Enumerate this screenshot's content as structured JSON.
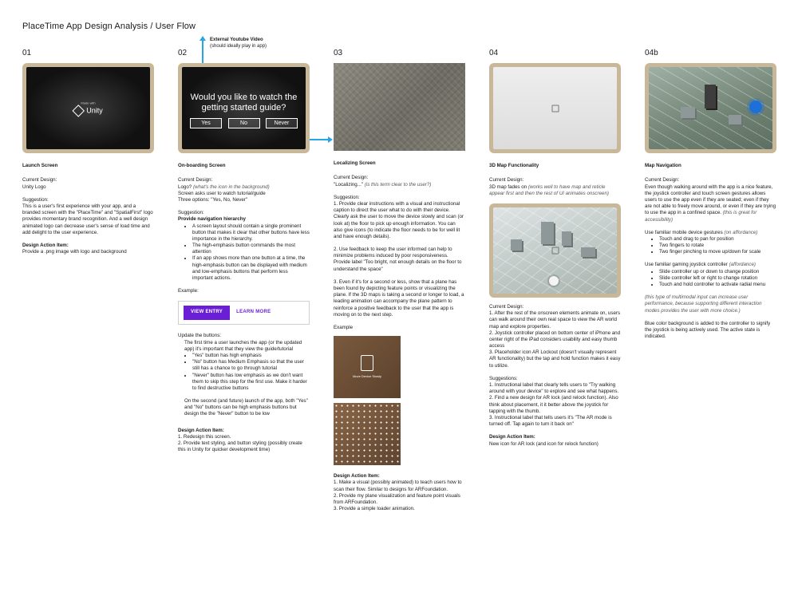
{
  "page_title": "PlaceTime App Design Analysis / User Flow",
  "annotation": {
    "label": "External Youtube Video",
    "sub": "(should ideally play in app)"
  },
  "col1": {
    "num": "01",
    "screen_caption": "Unity",
    "screen_small": "Made with",
    "heading": "Launch Screen",
    "current_label": "Current Design:",
    "current_text": "Unity Logo",
    "suggestion_label": "Suggestion:",
    "suggestion_text": "This is a user's first experience with your app, and a branded screen with the \"PlaceTime\" and \"SpatialFirst\" logo provides momentary brand recognition. And a well design animated logo can decrease user's sense of load time and add delight to the user experience.",
    "action_label": "Design Action Item:",
    "action_text": "Provide a .png image with logo and background"
  },
  "col2": {
    "num": "02",
    "screen_question": "Would you like to watch the getting started guide?",
    "btn_yes": "Yes",
    "btn_no": "No",
    "btn_never": "Never",
    "heading": "On-boarding Screen",
    "current_label": "Current Design:",
    "current_line1": "Logo?",
    "current_line1_note": "(what's the icon in the background)",
    "current_line2": "Screen asks user to watch tutorial/guide",
    "current_line3": "Three options: \"Yes, No, Never\"",
    "suggestion_label": "Suggestion:",
    "suggestion_sub": "Provide navigation hierarchy",
    "suggestion_items": [
      "A screen layout should contain a single prominent button that makes it clear that other buttons have less importance in the hierarchy.",
      "The high-emphasis button commands the most attention",
      "If an app shows more than one button at a time, the high-emphasis button can be displayed with medium and low-emphasis buttons that perform less important actions."
    ],
    "example_label": "Example:",
    "example_primary": "VIEW ENTRY",
    "example_secondary": "LEARN MORE",
    "update_label": "Update the buttons:",
    "update_intro": "The first time a user launches the app (or the updated app) it's important that they view the guide/tutorial",
    "update_items": [
      "\"Yes\" button has high emphasis",
      "\"No\" button has Medium Emphasis so that the user still has a chance to go through tutorial",
      "\"Never\" button has low emphasis as we don't want them to skip this step for the first use. Make it harder to find destructive buttons"
    ],
    "update_outro": "On the second (and future) launch of the app, both \"Yes\" and  \"No\" buttons can be high emphasis buttons but design the the \"Never\" button to be low",
    "action_label": "Design Action Item:",
    "action_items": [
      "1. Redesign this screen.",
      "2. Provide text styling, and button styling (possibly create this in Unity for quicker development time)"
    ]
  },
  "col3": {
    "num": "03",
    "heading": "Localizing Screen",
    "current_label": "Current Design:",
    "current_text": "\"Localizing...\"",
    "current_note": "(is this term clear to the user?)",
    "suggestion_label": "Suggestion:",
    "suggestions": [
      "1. Provide clear instructions with a visual and instructional caption to direct the user what to do with their device. Clearly ask the user to move the device slowly and scan (or look at) the floor to pick up enough information. You can also give icons (to indicate the floor needs to be for well lit and have enough details).",
      "2. Use feedback to keep the user informed can help to minimize problems induced by poor responsiveness. Provide label \"Too bright, not enough details on the floor to understand the space\"",
      "3. Even if it's for a second or less, show that a plane has been found by depicting feature points or visualizing the plane. If the 3D maps is taking a second or longer to load, a leading animation can accompany the plane pattern to reinforce a positive feedback to the user that the app is moving on to the next step."
    ],
    "example_label": "Example",
    "example_caption": "Move Device Slowly",
    "action_label": "Design Action Item:",
    "action_items": [
      "1. Make a visual (possibly animated) to teach users how to scan their flow. Similar to designs for ARFoundation.",
      "2. Provide my plane visualization and feature point visuals from ARFoundation.",
      "3. Provide a simple loader animation."
    ]
  },
  "col4": {
    "num": "04",
    "heading": "3D Map Functionality",
    "current_label": "Current Design:",
    "current_text": "3D map fades on",
    "current_note": "(works well to have map and reticle appear first and then the rest of UI animates onscreen)",
    "current2_label": "Current Design:",
    "current2_items": [
      "1. After the rest of the onscreen elements animate on, users can walk around their own real space to view the AR world map and explore properties.",
      "2. Joystick controller placed on bottom center of iPhone and center right of the iPad considers usability and easy thumb access",
      "3. Placeholder icon AR Lockout (doesn't visually represent AR functionality) but the tap and hold function makes it easy to utilize."
    ],
    "suggestions_label": "Suggestions:",
    "suggestions": [
      "1. Instructional label that clearly tells users to \"Try walking around with your device\" to explore and see what happens.",
      "2. Find a new design for AR lock (and relock function). Also think about placement, it it better above the joystick for tapping with the thumb.",
      "3. Instructional label that tells users it's \"The AR mode is turned off. Tap again to turn it back on\""
    ],
    "action_label": "Design Action Item:",
    "action_text": "New icon for AR lock (and icon for relock function)"
  },
  "col5": {
    "num": "04b",
    "heading": "Map Navigation",
    "current_label": "Current Design:",
    "current_text": "Even though walking around with the app is a nice feature, the joystick controller and touch screen gestures allows users to use the app even if they are seated; even if they are not able to freely move around, or even if they are trying to use the app in a confined space.",
    "current_note": "(this is great for accessibility)",
    "gestures_label": "Use familiar mobile device gestures",
    "gestures_note": "(on affordance)",
    "gestures": [
      "Touch and drag to pan for position",
      "Two fingers to rotate",
      "Two finger pinching to move up/down for scale"
    ],
    "joystick_label": "Use familiar gaming joystick controller",
    "joystick_note": "(affordance)",
    "joystick": [
      "Slide controller up or down to change position",
      "Slide controller left or right to change rotation",
      "Touch and hold controller to activate radial menu"
    ],
    "multimodal_note": "(this type of multimodal input can increase user performance, because supporting different interaction modes provides the user with more choice.)",
    "blue_text": "Blue color background is added to the controller to signify the joystick is being actively used. The active state is indicated."
  }
}
